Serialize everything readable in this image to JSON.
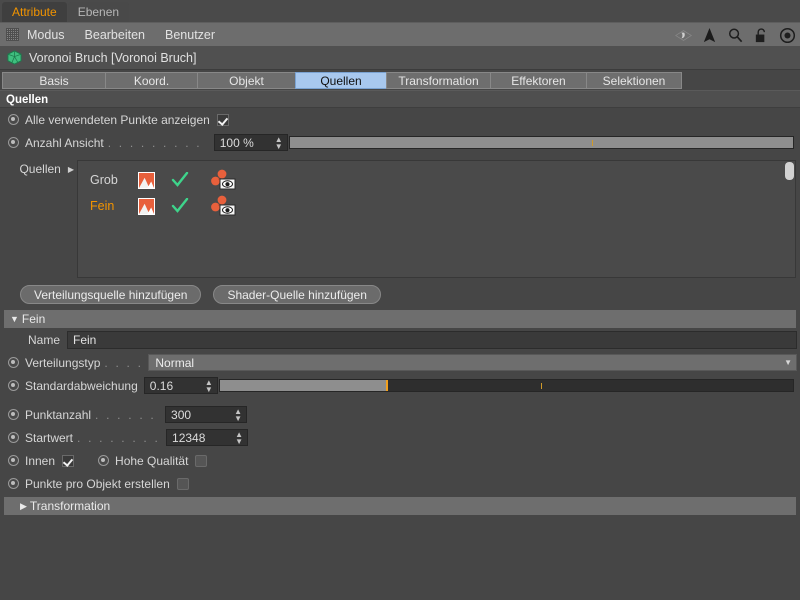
{
  "window": {
    "top_tabs": [
      {
        "label": "Attribute",
        "active": true
      },
      {
        "label": "Ebenen",
        "active": false
      }
    ],
    "menu_items": [
      "Modus",
      "Bearbeiten",
      "Benutzer"
    ],
    "menu_icons": [
      "ghost-icon",
      "cursor-arrow-icon",
      "search-icon",
      "unlock-icon",
      "target-icon"
    ]
  },
  "object": {
    "icon": "voronoi-fracture-icon",
    "title": "Voronoi Bruch [Voronoi Bruch]"
  },
  "tabs": [
    {
      "label": "Basis",
      "active": false
    },
    {
      "label": "Koord.",
      "active": false
    },
    {
      "label": "Objekt",
      "active": false
    },
    {
      "label": "Quellen",
      "active": true
    },
    {
      "label": "Transformation",
      "active": false
    },
    {
      "label": "Effektoren",
      "active": false
    },
    {
      "label": "Selektionen",
      "active": false
    }
  ],
  "quellen": {
    "group_title": "Quellen",
    "show_all_points": {
      "label": "Alle verwendeten Punkte anzeigen",
      "checked": true
    },
    "count_view": {
      "label": "Anzahl Ansicht",
      "dots": ". . . . . . . . . . . . . . . . .",
      "value": "100 %",
      "fill_percent": 100,
      "tick_percent": 60
    },
    "list_label": "Quellen",
    "sources": [
      {
        "name": "Grob",
        "highlighted": false,
        "thumb_icon": "shader-thumbnail-icon",
        "enabled_icon": "green-check-icon",
        "visibility_icon": "eye-visibility-icon"
      },
      {
        "name": "Fein",
        "highlighted": true,
        "thumb_icon": "shader-thumbnail-icon",
        "enabled_icon": "green-check-icon",
        "visibility_icon": "eye-visibility-icon"
      }
    ],
    "buttons": [
      {
        "label": "Verteilungsquelle hinzufügen"
      },
      {
        "label": "Shader-Quelle hinzufügen"
      }
    ]
  },
  "fein_group": {
    "title": "Fein",
    "expanded": true,
    "name_label": "Name",
    "name_value": "Fein",
    "distribution_type": {
      "label": "Verteilungstyp",
      "dots": ". . . . . .",
      "value": "Normal"
    },
    "standard_deviation": {
      "label": "Standardabweichung",
      "value": "0.16",
      "fill_percent": 29,
      "tick_percent": 56
    },
    "point_count": {
      "label": "Punktanzahl",
      "dots": ". . . . . . . . .",
      "value": "300"
    },
    "seed": {
      "label": "Startwert",
      "dots": ". . . . . . . . . . .",
      "value": "12348"
    },
    "inside": {
      "label": "Innen",
      "checked": true
    },
    "high_quality": {
      "label": "Hohe Qualität",
      "checked": false
    },
    "points_per_object": {
      "label": "Punkte pro Objekt erstellen",
      "checked": false
    },
    "transformation": {
      "label": "Transformation",
      "expanded": false
    }
  },
  "colors": {
    "accent_orange": "#f29400",
    "tab_active_blue": "#a8c8ee",
    "check_green": "#3ed48b",
    "panel_bg": "#464646",
    "slider_mark": "#f2a01e"
  }
}
